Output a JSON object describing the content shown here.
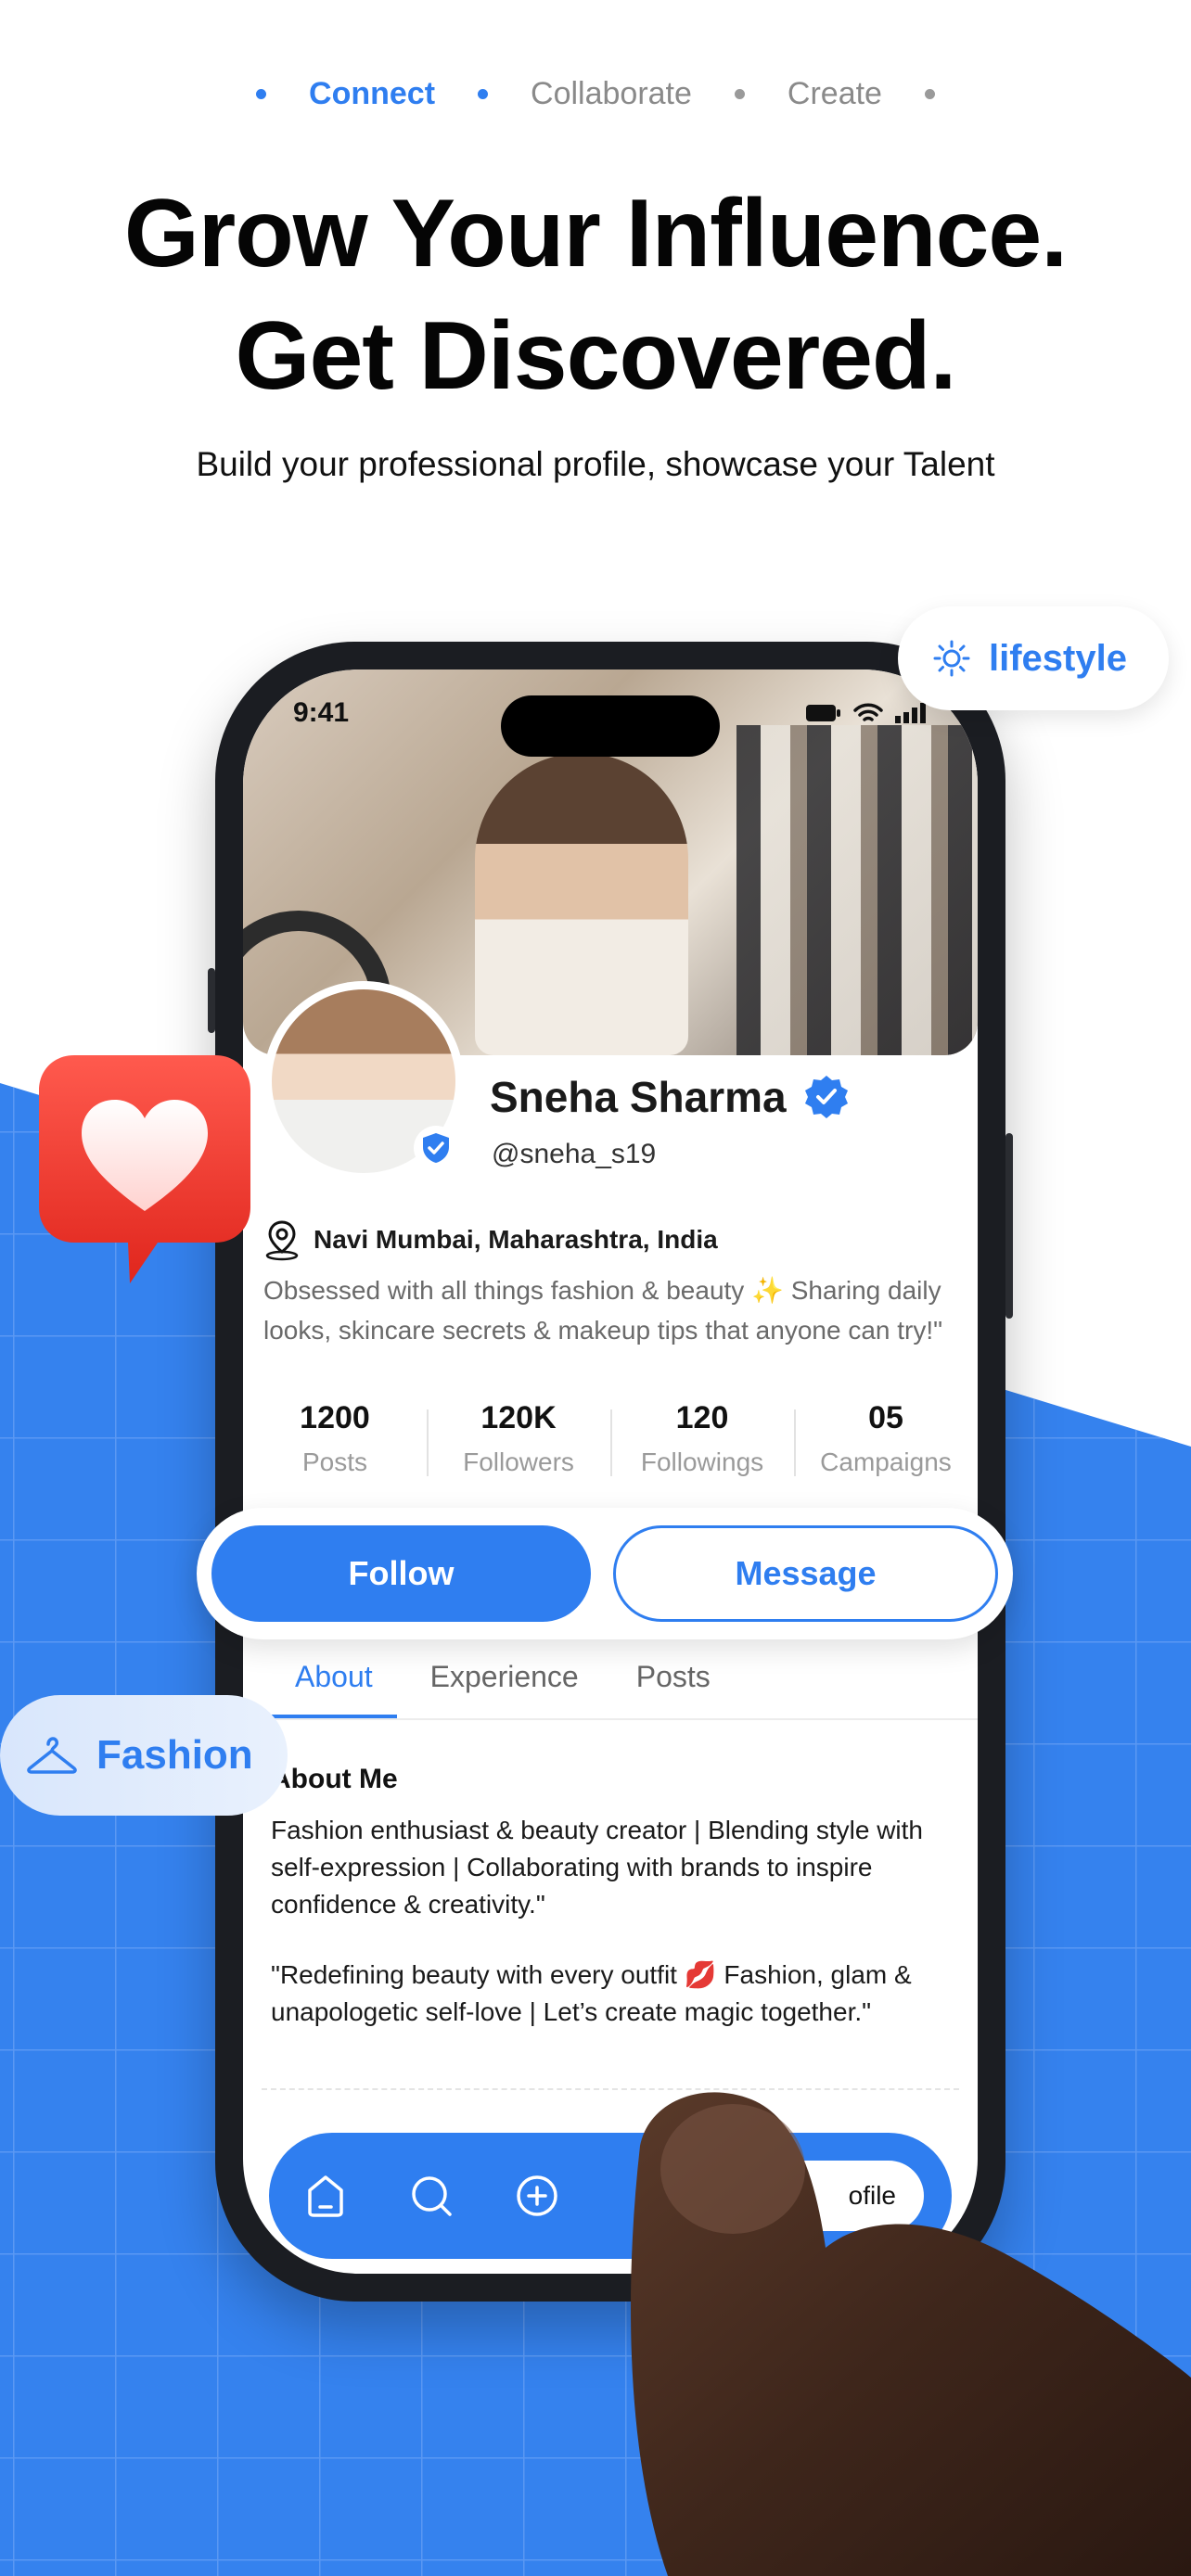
{
  "steps": [
    {
      "label": "Connect",
      "active": true
    },
    {
      "label": "Collaborate",
      "active": false
    },
    {
      "label": "Create",
      "active": false
    }
  ],
  "headline": {
    "line1": "Grow Your Influence.",
    "line2": "Get Discovered."
  },
  "subline": "Build your professional profile, showcase your Talent",
  "chips": {
    "lifestyle": "lifestyle",
    "fashion": "Fashion"
  },
  "phone": {
    "status_time": "9:41",
    "profile": {
      "name": "Sneha Sharma",
      "handle": "@sneha_s19",
      "location": "Navi Mumbai, Maharashtra, India",
      "bio": "Obsessed with all things fashion & beauty ✨ Sharing daily looks, skincare secrets & makeup tips that anyone can try!\"",
      "stats": [
        {
          "value": "1200",
          "label": "Posts"
        },
        {
          "value": "120K",
          "label": "Followers"
        },
        {
          "value": "120",
          "label": "Followings"
        },
        {
          "value": "05",
          "label": "Campaigns"
        }
      ]
    },
    "actions": {
      "follow": "Follow",
      "message": "Message"
    },
    "tabs": [
      {
        "label": "About",
        "active": true
      },
      {
        "label": "Experience",
        "active": false
      },
      {
        "label": "Posts",
        "active": false
      }
    ],
    "about": {
      "heading": "About Me",
      "para1": "Fashion enthusiast & beauty creator | Blending style with self-expression | Collaborating with brands to inspire confidence & creativity.\"",
      "para2": "\"Redefining beauty with every outfit 💋 Fashion, glam & unapologetic self-love | Let’s create magic together.\""
    },
    "bottom_nav": {
      "icons": [
        "home-icon",
        "search-icon",
        "add-icon"
      ],
      "profile_label": "ofile"
    }
  },
  "colors": {
    "accent": "#2f7ef0",
    "heart": "#f0382e"
  }
}
